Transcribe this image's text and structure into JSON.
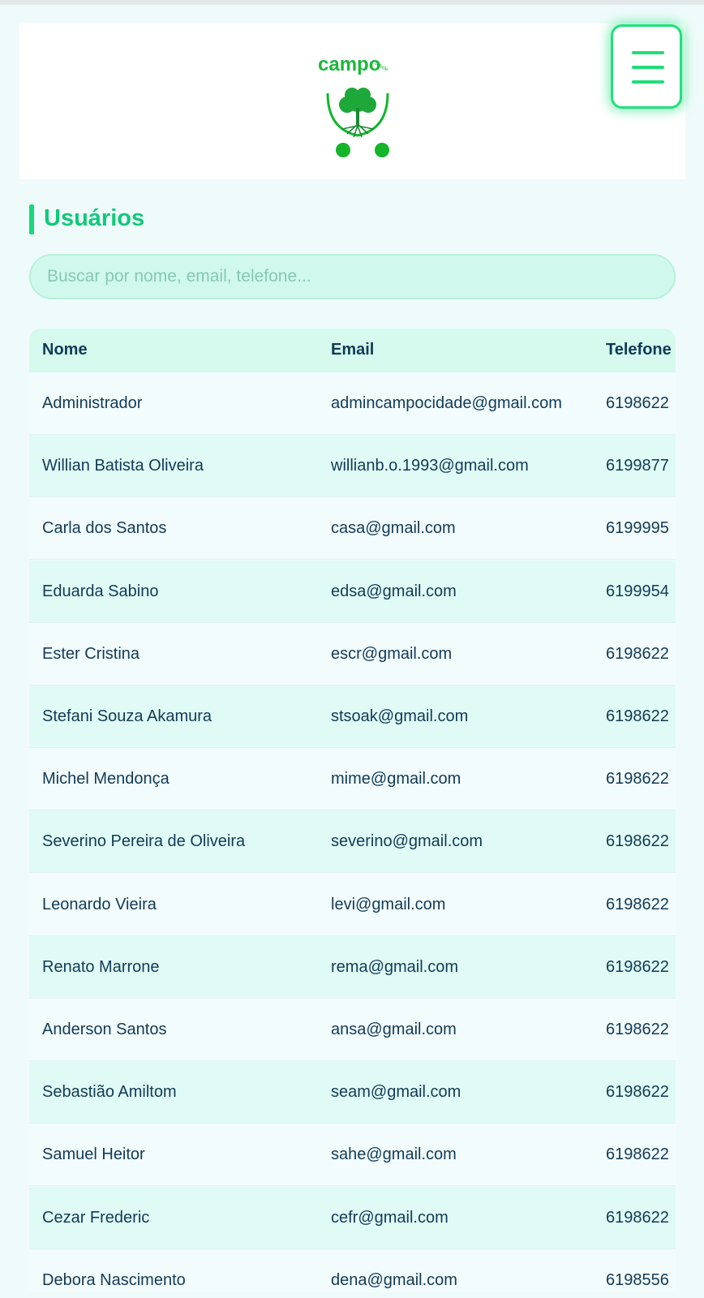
{
  "header": {
    "logo_text": "campo",
    "logo_subtext": "cidade",
    "menu_button": "hamburger-menu-icon"
  },
  "page": {
    "title": "Usuários"
  },
  "search": {
    "placeholder": "Buscar por nome, email, telefone..."
  },
  "table": {
    "columns": [
      "Nome",
      "Email",
      "Telefone"
    ],
    "rows": [
      {
        "nome": "Administrador",
        "email": "admincampocidade@gmail.com",
        "telefone": "6198622"
      },
      {
        "nome": "Willian Batista Oliveira",
        "email": "willianb.o.1993@gmail.com",
        "telefone": "6199877"
      },
      {
        "nome": "Carla dos Santos",
        "email": "casa@gmail.com",
        "telefone": "6199995"
      },
      {
        "nome": "Eduarda Sabino",
        "email": "edsa@gmail.com",
        "telefone": "6199954"
      },
      {
        "nome": "Ester Cristina",
        "email": "escr@gmail.com",
        "telefone": "6198622"
      },
      {
        "nome": "Stefani Souza Akamura",
        "email": "stsoak@gmail.com",
        "telefone": "6198622"
      },
      {
        "nome": "Michel Mendonça",
        "email": "mime@gmail.com",
        "telefone": "6198622"
      },
      {
        "nome": "Severino Pereira de Oliveira",
        "email": "severino@gmail.com",
        "telefone": "6198622"
      },
      {
        "nome": "Leonardo Vieira",
        "email": "levi@gmail.com",
        "telefone": "6198622"
      },
      {
        "nome": "Renato Marrone",
        "email": "rema@gmail.com",
        "telefone": "6198622"
      },
      {
        "nome": "Anderson Santos",
        "email": "ansa@gmail.com",
        "telefone": "6198622"
      },
      {
        "nome": "Sebastião Amiltom",
        "email": "seam@gmail.com",
        "telefone": "6198622"
      },
      {
        "nome": "Samuel Heitor",
        "email": "sahe@gmail.com",
        "telefone": "6198622"
      },
      {
        "nome": "Cezar Frederic",
        "email": "cefr@gmail.com",
        "telefone": "6198622"
      },
      {
        "nome": "Debora Nascimento",
        "email": "dena@gmail.com",
        "telefone": "6198556"
      }
    ]
  },
  "colors": {
    "accent": "#10c97a",
    "menu_border": "#22e07f",
    "row_even": "#f2fcfd",
    "row_odd": "#e0fbf5",
    "text": "#123a56"
  }
}
